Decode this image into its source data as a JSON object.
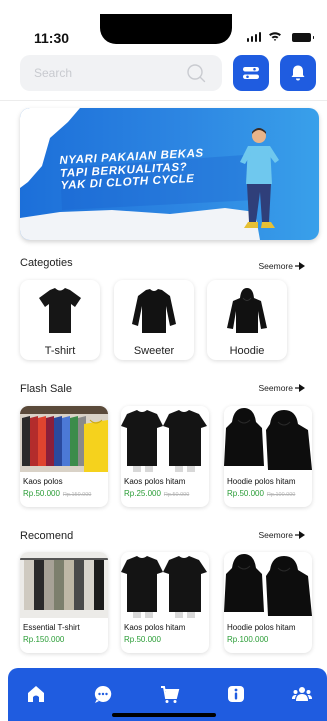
{
  "status": {
    "time": "11:30"
  },
  "search": {
    "placeholder": "Search"
  },
  "banner": {
    "lines": [
      "NYARI PAKAIAN BEKAS",
      "TAPI BERKUALITAS?",
      "YAK DI CLOTH CYCLE"
    ]
  },
  "categories": {
    "title": "Categoties",
    "seemore": "Seemore",
    "items": [
      {
        "label": "T-shirt",
        "icon": "tshirt-icon"
      },
      {
        "label": "Sweeter",
        "icon": "sweater-icon"
      },
      {
        "label": "Hoodie",
        "icon": "hoodie-icon"
      }
    ]
  },
  "flash_sale": {
    "title": "Flash Sale",
    "seemore": "Seemore",
    "items": [
      {
        "name": "Kaos polos",
        "price": "Rp.50.000",
        "old_price": "Rp.150.000"
      },
      {
        "name": "Kaos polos hitam",
        "price": "Rp.25.000",
        "old_price": "Rp.50.000"
      },
      {
        "name": "Hoodie polos hitam",
        "price": "Rp.50.000",
        "old_price": "Rp.100.000"
      }
    ]
  },
  "recommend": {
    "title": "Recomend",
    "seemore": "Seemore",
    "items": [
      {
        "name": "Essential T-shirt",
        "price": "Rp.150.000"
      },
      {
        "name": "Kaos polos hitam",
        "price": "Rp.50.000"
      },
      {
        "name": "Hoodie polos hitam",
        "price": "Rp.100.000"
      }
    ]
  },
  "nav": {
    "items": [
      "home-icon",
      "chat-icon",
      "cart-icon",
      "info-icon",
      "community-icon"
    ]
  },
  "colors": {
    "primary": "#1f5ce0",
    "price": "#2a9d36",
    "banner": "#2d86e2"
  }
}
